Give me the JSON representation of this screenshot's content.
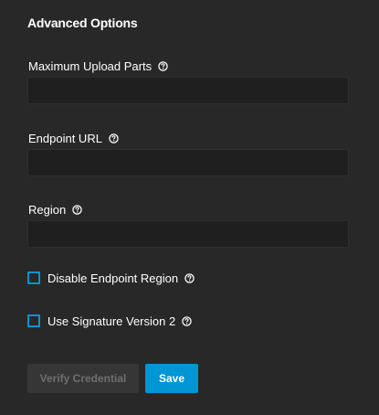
{
  "section": {
    "title": "Advanced Options"
  },
  "fields": {
    "max_upload_parts": {
      "label": "Maximum Upload Parts",
      "value": ""
    },
    "endpoint_url": {
      "label": "Endpoint URL",
      "value": ""
    },
    "region": {
      "label": "Region",
      "value": ""
    }
  },
  "checkboxes": {
    "disable_endpoint_region": {
      "label": "Disable Endpoint Region",
      "checked": false
    },
    "use_signature_v2": {
      "label": "Use Signature Version 2",
      "checked": false
    }
  },
  "buttons": {
    "verify_label": "Verify Credential",
    "save_label": "Save"
  },
  "colors": {
    "background": "#282828",
    "input_background": "#1f1f1f",
    "accent": "#0095d5",
    "disabled_button": "#363636",
    "disabled_text": "#6e6e6e"
  },
  "icons": {
    "help": "help-circle-icon"
  }
}
